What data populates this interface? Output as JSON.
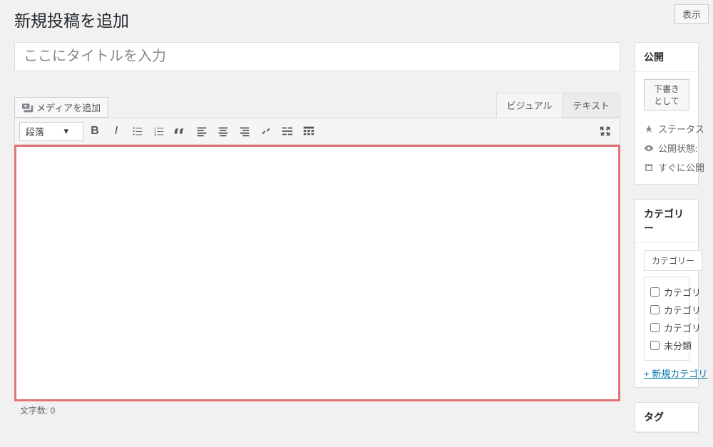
{
  "topButton": "表示",
  "pageTitle": "新規投稿を追加",
  "titlePlaceholder": "ここにタイトルを入力",
  "mediaButton": "メディアを追加",
  "editorTabs": {
    "visual": "ビジュアル",
    "text": "テキスト"
  },
  "formatSelect": "段落",
  "wordCount": "文字数: 0",
  "publish": {
    "header": "公開",
    "saveDraft": "下書きとして",
    "statusLabel": "ステータス",
    "visibilityLabel": "公開状態:",
    "scheduleLabel": "すぐに公開"
  },
  "categories": {
    "header": "カテゴリー",
    "tab1": "カテゴリー",
    "items": [
      "カテゴリ",
      "カテゴリ",
      "カテゴリ",
      "未分類"
    ],
    "addLink": "+ 新規カテゴリ"
  },
  "tags": {
    "header": "タグ"
  }
}
